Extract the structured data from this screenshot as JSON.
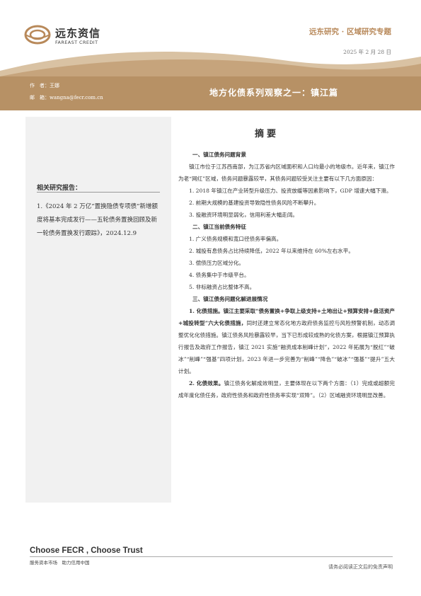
{
  "header": {
    "logo_cn": "远东资信",
    "logo_en": "FAREAST CREDIT",
    "series": "远东研究 · 区域研究专题",
    "date": "2025 年 2 月 28 日"
  },
  "band": {
    "author": "作　者：王娜",
    "email": "邮　箱：wangna@fecr.com.cn",
    "title": "地方化债系列观察之一：镇江篇"
  },
  "sidebar": {
    "heading": "相关研究报告：",
    "item": "1.《2024 年 2 万亿“置换隐债专项债”新增额度将基本完成发行——五轮债务置换回顾及新一轮债务置换发行跟踪》，2024.12.9"
  },
  "abstract": {
    "title": "摘要",
    "s1_head": "一、镇江债务问题背景",
    "s1_p": "镇江市位于江苏西南部，为江苏省内区域面积和人口均最小的地级市。近年来，镇江作为老“网红”区域，债务问题暴露较早，其债务问题较受关注主要有以下几方面原因：",
    "s1_i1": "1. 2018 年镇江在产业转型升级压力、投资放缓等因素影响下，GDP 增速大幅下滑。",
    "s1_i2": "2. 前期大规模的基建投资导致隐性债务风险不断攀升。",
    "s1_i3": "3. 投融资环境明显弱化，信用利差大幅走阔。",
    "s2_head": "二、镇江当前债务特征",
    "s2_i1": "1. 广义债务规模和宽口径债务率偏高。",
    "s2_i2": "2. 城投有息债务占比持续降低，2022 年以来维持在 60%左右水平。",
    "s2_i3": "3. 偿债压力区域分化。",
    "s2_i4": "4. 债务集中于市级平台。",
    "s2_i5": "5. 非标融资占比整体不高。",
    "s3_head": "三、镇江债务问题化解进展情况",
    "s3_i1_lead": "1. 化债措施。镇江主要采取“债务置换+争取上级支持+土地出让+预算安排+盘活资产+城投转型”六大化债措施，",
    "s3_i1_rest": "同时还建立常态化地方政府债务监控与风险预警机制，动态调整优化化债措施。镇江债务风险暴露较早，当下已形成较成熟的化债方案，根据镇江预算执行报告及政府工作报告，镇江 2021 实施“融资成本削峰计划”，2022 年拓展为“脱红”“破冰”“削峰”“强基”四项计划，2023 年进一步完善为“削峰”“降色”“破冰”“强基”“提升”五大计划。",
    "s3_i2_lead": "2. 化债效果。",
    "s3_i2_rest": "镇江债务化解成效明显，主要体现在以下两个方面：（1）完成或超额完成年度化债任务，政府性债务和政府性债务率实现“双降”。（2）区域融资环境明显改善。"
  },
  "footer": {
    "slogan": "Choose FECR , Choose Trust",
    "sub": "服务资本市场　助力信用中国",
    "note": "请务必阅读正文后的免责声明"
  },
  "colors": {
    "gold": "#b79165",
    "sidebar_bg": "#f1f1f1"
  }
}
